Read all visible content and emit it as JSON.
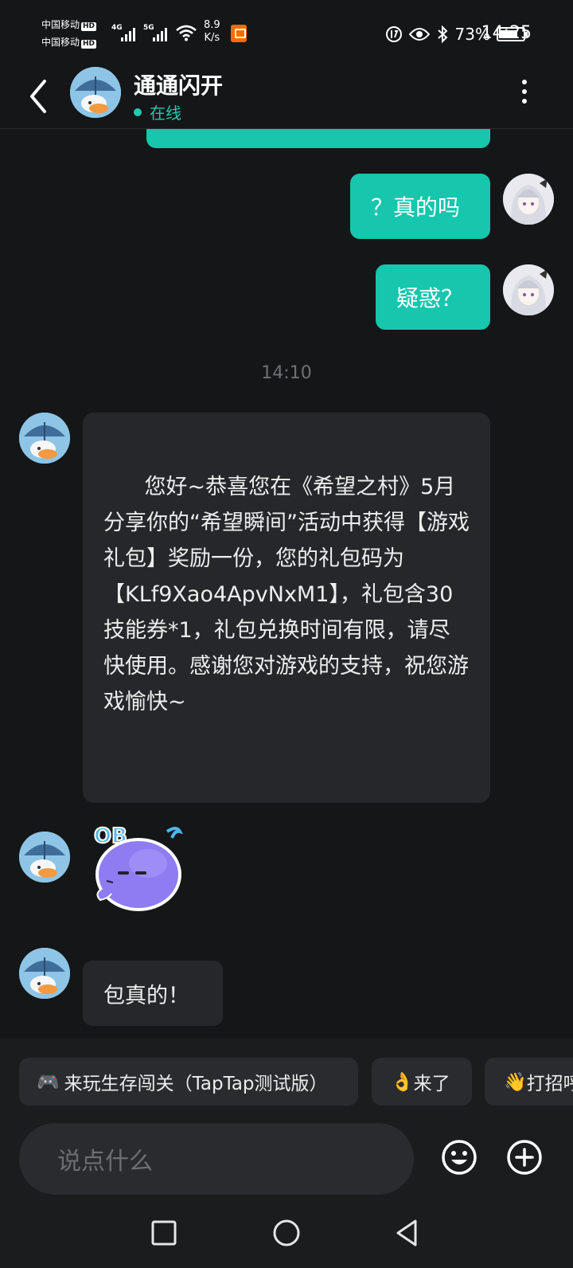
{
  "status_bar": {
    "carrier1": "中国移动",
    "carrier2": "中国移动",
    "hd_badge": "HD",
    "net1": "4G",
    "net2": "5G",
    "speed_value": "8.9",
    "speed_unit": "K/s",
    "battery": "73%",
    "time": "14:25",
    "icons": [
      "nfc-icon",
      "eye-icon",
      "bluetooth-icon",
      "battery-icon"
    ]
  },
  "header": {
    "title": "通通闪开",
    "status": "在线"
  },
  "messages": [
    {
      "side": "out",
      "text": "？真的吗"
    },
    {
      "side": "out",
      "text": "疑惑？"
    },
    {
      "type": "time",
      "text": "14:10"
    },
    {
      "side": "in",
      "text": "您好~恭喜您在《希望之村》5月分享你的“希望瞬间”活动中获得【游戏礼包】奖励一份，您的礼包码为【KLf9Xao4ApvNxM1】，礼包含30技能券*1，礼包兑换时间有限，请尽快使用。感谢您对游戏的支持，祝您游戏愉快~"
    },
    {
      "side": "in",
      "type": "sticker",
      "sticker_text": "OB"
    },
    {
      "side": "in",
      "text": "包真的！"
    }
  ],
  "quick_replies": [
    {
      "icon": "gamepad-icon",
      "emoji": "🎮",
      "label": "来玩生存闯关（TapTap测试版）"
    },
    {
      "icon": "ok-hand-icon",
      "emoji": "👌",
      "label": "来了"
    },
    {
      "icon": "wave-hand-icon",
      "emoji": "👋",
      "label": "打招呼"
    }
  ],
  "composer": {
    "placeholder": "说点什么"
  },
  "colors": {
    "accent": "#16c6ad",
    "online": "#22c9b0",
    "background": "#151617",
    "bubble_in": "#26272a"
  }
}
